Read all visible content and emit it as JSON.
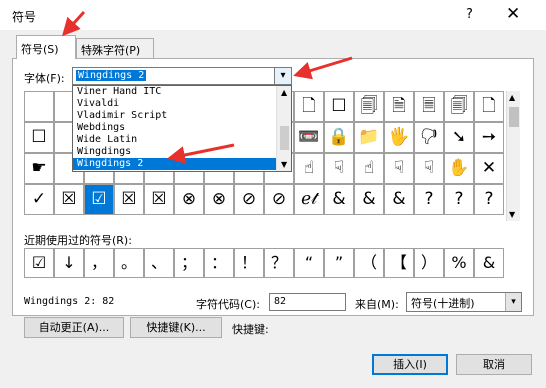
{
  "window": {
    "title": "符号",
    "help_glyph": "?",
    "close_glyph": "✕"
  },
  "tabs": [
    {
      "label": "符号(S)"
    },
    {
      "label": "特殊字符(P)"
    }
  ],
  "font": {
    "label": "字体(F):",
    "value": "Wingdings 2",
    "dropdown_options": [
      "Viner Hand ITC",
      "Vivaldi",
      "Vladimir Script",
      "Webdings",
      "Wide Latin",
      "Wingdings",
      "Wingdings 2"
    ],
    "selected_index": 6
  },
  "symbol_grid": {
    "rows": [
      [
        "",
        "",
        "",
        "",
        "",
        "",
        "",
        "",
        "",
        "🗋",
        "☐",
        "🗐",
        "🗎",
        "🗏",
        "🗐",
        "🗋"
      ],
      [
        "☐",
        "",
        "",
        "",
        "",
        "",
        "",
        "",
        "",
        "📼",
        "🔒",
        "📁",
        "🖐",
        "🖓",
        "➘",
        "➙"
      ],
      [
        "☛",
        "",
        "",
        "",
        "",
        "",
        "",
        "",
        "",
        "☝",
        "☟",
        "☝",
        "☟",
        "☟",
        "✋",
        "✕"
      ],
      [
        "✓",
        "☒",
        "☑",
        "☒",
        "☒",
        "⊗",
        "⊗",
        "⊘",
        "⊘",
        "ℯ𝓉",
        "&",
        "&",
        "&",
        "?",
        "?",
        "?"
      ]
    ],
    "selected": "☑"
  },
  "recent": {
    "label": "近期使用过的符号(R):",
    "symbols": [
      "☑",
      "↓",
      "，",
      "。",
      "、",
      "；",
      "：",
      "！",
      "？",
      "“",
      "”",
      "（",
      "【",
      "）",
      "%",
      "&"
    ]
  },
  "status": {
    "char_name": "Wingdings 2: 82"
  },
  "char_code": {
    "label": "字符代码(C):",
    "value": "82"
  },
  "from": {
    "label": "来自(M):",
    "value": "符号(十进制)"
  },
  "buttons": {
    "autocorrect": "自动更正(A)...",
    "shortcut": "快捷键(K)...",
    "shortcut_label": "快捷键:",
    "insert": "插入(I)",
    "cancel": "取消"
  },
  "colors": {
    "accent": "#0078d7",
    "annotation": "#e8302c"
  }
}
